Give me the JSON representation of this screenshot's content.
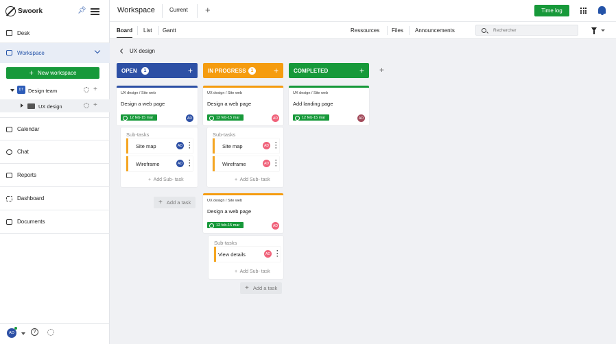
{
  "sidebar": {
    "brand": "Swoork",
    "nav": [
      {
        "label": "Desk"
      },
      {
        "label": "Workspace"
      }
    ],
    "new_workspace": "New workspace",
    "tree": [
      {
        "badge": "DT",
        "label": "Design team"
      },
      {
        "label": "UX design"
      }
    ],
    "bottom_nav": [
      {
        "label": "Calendar"
      },
      {
        "label": "Chat"
      },
      {
        "label": "Reports"
      },
      {
        "label": "Dashboard"
      },
      {
        "label": "Documents"
      }
    ],
    "user_initials": "AD"
  },
  "topbar": {
    "title": "Workspace",
    "current_tab": "Current",
    "time_log": "Time log"
  },
  "tabs": {
    "left": [
      "Board",
      "List",
      "Gantt"
    ],
    "right": [
      "Ressources",
      "Files",
      "Announcements"
    ],
    "search_placeholder": "Rechercher"
  },
  "breadcrumb": "UX design",
  "columns": [
    {
      "name": "OPEN",
      "count": "1",
      "color": "#2d50a5"
    },
    {
      "name": "IN PROGRESS",
      "count": "1",
      "color": "#f59c0f"
    },
    {
      "name": "COMPLETED",
      "color": "#17993a"
    }
  ],
  "cards": [
    {
      "path": "UX design / Site web",
      "title": "Design a web page",
      "date": "12 feb-15 mar",
      "avatar": "AD",
      "avatar_color": "#2d50a5"
    },
    {
      "path": "UX design / Site web",
      "title": "Design a web page",
      "date": "12 feb-15 mar",
      "avatar": "AD",
      "avatar_color": "#f0627a"
    },
    {
      "path": "UX design / Site web",
      "title": "Add landing page",
      "date": "12 feb-15 mar",
      "avatar": "AD",
      "avatar_color": "#a24a5a"
    },
    {
      "path": "UX design / Site web",
      "title": "Design a web page",
      "date": "12 feb-15 mar",
      "avatar": "AD",
      "avatar_color": "#f0627a"
    }
  ],
  "subtasks": {
    "header": "Sub-tasks",
    "add_label": "Add Sub- task",
    "open": [
      {
        "label": "Site map",
        "avatar": "AD"
      },
      {
        "label": "Wireframe",
        "avatar": "AD"
      }
    ],
    "progress": [
      {
        "label": "Site map",
        "avatar": "AD"
      },
      {
        "label": "Wireframe",
        "avatar": "AD"
      }
    ],
    "progress2": [
      {
        "label": "View details",
        "avatar": "AD"
      }
    ]
  },
  "add_task": "Add a task"
}
